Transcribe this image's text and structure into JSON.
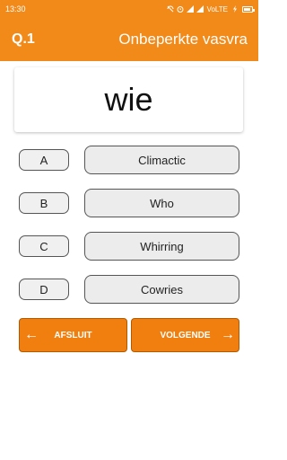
{
  "status_bar": {
    "time": "13:30",
    "network": "VoLTE"
  },
  "app_bar": {
    "question_number": "Q.1",
    "title": "Onbeperkte vasvra"
  },
  "question": {
    "word": "wie"
  },
  "options": [
    {
      "letter": "A",
      "answer": "Climactic"
    },
    {
      "letter": "B",
      "answer": "Who"
    },
    {
      "letter": "C",
      "answer": "Whirring"
    },
    {
      "letter": "D",
      "answer": "Cowries"
    }
  ],
  "nav": {
    "quit_label": "AFSLUIT",
    "next_label": "VOLGENDE",
    "left_arrow": "←",
    "right_arrow": "→"
  },
  "colors": {
    "accent": "#f28a1a",
    "button_orange": "#f07f0f"
  }
}
